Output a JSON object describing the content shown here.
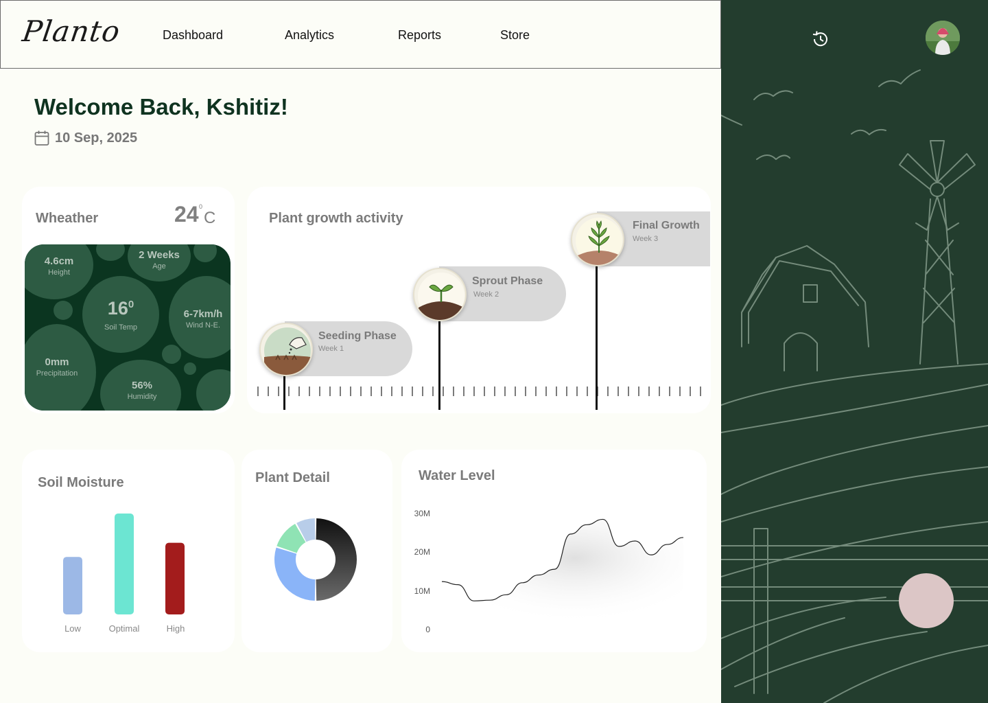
{
  "header": {
    "logo": "Planto",
    "nav": [
      {
        "label": "Dashboard"
      },
      {
        "label": "Analytics"
      },
      {
        "label": "Reports"
      },
      {
        "label": "Store"
      }
    ]
  },
  "welcome": {
    "greeting": "Welcome Back, Kshitiz!",
    "date": "10 Sep, 2025"
  },
  "weather": {
    "title": "Wheather",
    "temperature": "24",
    "degree_symbol": "0",
    "unit": "C",
    "stats": [
      {
        "value": "4.6cm",
        "label": "Height"
      },
      {
        "value": "2 Weeks",
        "label": "Age"
      },
      {
        "value": "16",
        "sup": "0",
        "label": "Soil Temp"
      },
      {
        "value": "6-7km/h",
        "label": "Wind N-E."
      },
      {
        "value": "0mm",
        "label": "Precipitation"
      },
      {
        "value": "56%",
        "label": "Humidity"
      }
    ]
  },
  "growth": {
    "title": "Plant growth activity",
    "phases": [
      {
        "name": "Seeding Phase",
        "week": "Week 1"
      },
      {
        "name": "Sprout Phase",
        "week": "Week 2"
      },
      {
        "name": "Final Growth",
        "week": "Week 3"
      }
    ]
  },
  "soil": {
    "title": "Soil Moisture",
    "chart_data": {
      "type": "bar",
      "categories": [
        "Low",
        "Optimal",
        "High"
      ],
      "values": [
        57,
        100,
        71
      ],
      "colors": [
        "#9cb8e6",
        "#6ce5d2",
        "#a31c1c"
      ]
    }
  },
  "plant_detail": {
    "title": "Plant Detail",
    "chart_data": {
      "type": "pie",
      "slices": [
        {
          "value": 50,
          "color": "#2a2a2a"
        },
        {
          "value": 30,
          "color": "#8ab4f8"
        },
        {
          "value": 12,
          "color": "#8fe3b4"
        },
        {
          "value": 8,
          "color": "#b8cde9"
        }
      ]
    }
  },
  "water": {
    "title": "Water Level",
    "chart_data": {
      "type": "line",
      "yticks": [
        "30M",
        "20M",
        "10M",
        "0"
      ],
      "ylim": [
        0,
        30
      ],
      "values": [
        12.4,
        11.6,
        7.4,
        7.6,
        9.0,
        12.1,
        14.1,
        15.6,
        24.7,
        27.1,
        28.5,
        21.5,
        22.9,
        19.3,
        22.0,
        23.8
      ]
    }
  },
  "side": {
    "history_icon": "history-icon",
    "avatar": "user-avatar"
  }
}
